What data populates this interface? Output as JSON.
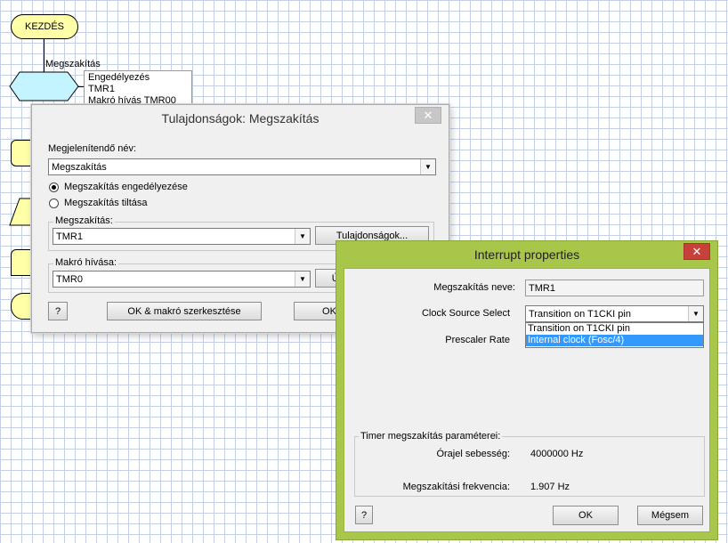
{
  "flowchart": {
    "start_label": "KEZDÉS",
    "interrupt_label": "Megszakítás",
    "comment_lines": [
      "Engedélyezés",
      "TMR1",
      "Makró hívás TMR00"
    ]
  },
  "properties_dialog": {
    "title": "Tulajdonságok: Megszakítás",
    "close_glyph": "✕",
    "display_name_label": "Megjelenítendő név:",
    "display_name_value": "Megszakítás",
    "radio_enable_label": "Megszakítás engedélyezése",
    "radio_disable_label": "Megszakítás tiltása",
    "interrupt_group_label": "Megszakítás:",
    "interrupt_value": "TMR1",
    "properties_button": "Tulajdonságok...",
    "macro_group_label": "Makró hívása:",
    "macro_value": "TMR0",
    "new_button": "Új m",
    "help_button": "?",
    "ok_edit_button": "OK & makró szerkesztése",
    "ok_button": "OK"
  },
  "interrupt_properties": {
    "title": "Interrupt properties",
    "close_glyph": "✕",
    "name_label": "Megszakítás neve:",
    "name_value": "TMR1",
    "clock_source_label": "Clock Source Select",
    "clock_source_value": "Transition on T1CKI pin",
    "clock_source_options": [
      "Transition on T1CKI pin",
      "Internal clock (Fosc/4)"
    ],
    "selected_option_index": 1,
    "prescaler_label": "Prescaler Rate",
    "timer_group_label": "Timer megszakítás paraméterei:",
    "clock_speed_label": "Órajel sebesség:",
    "clock_speed_value": "4000000 Hz",
    "interrupt_freq_label": "Megszakítási frekvencia:",
    "interrupt_freq_value": "1.907 Hz",
    "help_button": "?",
    "ok_button": "OK",
    "cancel_button": "Mégsem"
  },
  "colors": {
    "window_accent": "#a7c64a",
    "selection": "#3399ff",
    "close_red": "#c7403a",
    "flow_start_fill": "#ffffa8",
    "flow_interrupt_fill": "#c4f4ff"
  }
}
